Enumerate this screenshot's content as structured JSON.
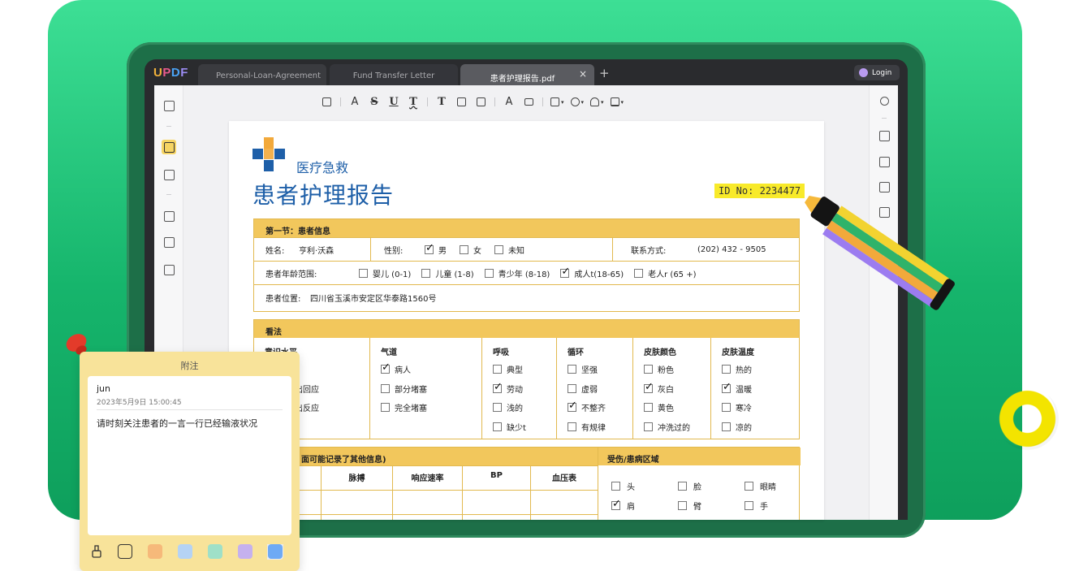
{
  "app": {
    "logo": "UPDF",
    "tabs": [
      {
        "label": "Personal-Loan-Agreement"
      },
      {
        "label": "Fund Transfer Letter"
      },
      {
        "label": "患者护理报告.pdf"
      }
    ],
    "tab_close": "×",
    "tab_add": "+",
    "login_label": "Login"
  },
  "colors": {
    "accent_green": "#16b56c",
    "section_header": "#f2c75c",
    "brand_blue": "#1e5fa8",
    "id_highlight": "#f8ea2a"
  },
  "toolbar": {
    "tools": [
      "comment-icon",
      "highlight-icon",
      "strikethrough-icon",
      "underline-icon",
      "squiggly-icon",
      "text-icon",
      "textbox-icon",
      "text-callout-icon",
      "pencil-icon",
      "eraser-icon",
      "shape-icon",
      "pen-color-icon",
      "stamp-icon",
      "signature-icon"
    ],
    "glyphs": {
      "strike": "S",
      "underline": "U",
      "squiggly": "T",
      "text": "T"
    }
  },
  "document": {
    "brand_name": "医疗急救",
    "title": "患者护理报告",
    "id_label": "ID No: 2234477",
    "section1": {
      "title": "第一节：患者信息",
      "name_label": "姓名:",
      "name_value": "亨利·沃森",
      "gender_label": "性别:",
      "gender_options": [
        {
          "label": "男",
          "checked": true
        },
        {
          "label": "女",
          "checked": false
        },
        {
          "label": "未知",
          "checked": false
        }
      ],
      "contact_label": "联系方式:",
      "contact_value": "(202) 432 - 9505",
      "age_label": "患者年龄范围:",
      "age_options": [
        {
          "label": "婴儿 (0-1)",
          "checked": false
        },
        {
          "label": "儿童 (1-8)",
          "checked": false
        },
        {
          "label": "青少年 (8-18)",
          "checked": false
        },
        {
          "label": "成人t(18-65)",
          "checked": true
        },
        {
          "label": "老人r (65 +)",
          "checked": false
        }
      ],
      "location_label": "患者位置:",
      "location_value": "四川省玉溪市安定区华泰路1560号"
    },
    "section2": {
      "title": "看法",
      "columns": [
        {
          "header": "意识水平",
          "items": [
            {
              "label": "",
              "checked": false
            },
            {
              "label": "音做出回应",
              "checked": false
            },
            {
              "label": "痛做出反应",
              "checked": false
            },
            {
              "label": "应",
              "checked": false
            }
          ]
        },
        {
          "header": "气道",
          "items": [
            {
              "label": "病人",
              "checked": true
            },
            {
              "label": "部分堵塞",
              "checked": false
            },
            {
              "label": "完全堵塞",
              "checked": false
            }
          ]
        },
        {
          "header": "呼吸",
          "items": [
            {
              "label": "典型",
              "checked": false
            },
            {
              "label": "劳动",
              "checked": true
            },
            {
              "label": "浅的",
              "checked": false
            },
            {
              "label": "缺少t",
              "checked": false
            }
          ]
        },
        {
          "header": "循环",
          "items": [
            {
              "label": "坚强",
              "checked": false
            },
            {
              "label": "虚弱",
              "checked": false
            },
            {
              "label": "不整齐",
              "checked": true
            },
            {
              "label": "有规律",
              "checked": false
            }
          ]
        },
        {
          "header": "皮肤颜色",
          "items": [
            {
              "label": "粉色",
              "checked": false
            },
            {
              "label": "灰白",
              "checked": true
            },
            {
              "label": "黄色",
              "checked": false
            },
            {
              "label": "冲洗过的",
              "checked": false
            }
          ]
        },
        {
          "header": "皮肤温度",
          "items": [
            {
              "label": "热的",
              "checked": false
            },
            {
              "label": "温暖",
              "checked": true
            },
            {
              "label": "寒冷",
              "checked": false
            },
            {
              "label": "凉的",
              "checked": false
            }
          ]
        }
      ]
    },
    "section3": {
      "title": "面可能记录了其他信息)",
      "vitals_headers": [
        "脉搏",
        "响应速率",
        "BP",
        "血压表"
      ],
      "injury_title": "受伤/患病区域",
      "injury_options": [
        {
          "label": "头",
          "checked": false
        },
        {
          "label": "脸",
          "checked": false
        },
        {
          "label": "眼睛",
          "checked": false
        },
        {
          "label": "肩",
          "checked": true
        },
        {
          "label": "臂",
          "checked": false
        },
        {
          "label": "手",
          "checked": false
        }
      ]
    }
  },
  "note": {
    "title": "附注",
    "author": "jun",
    "timestamp": "2023年5月9日 15:00:45",
    "text": "请时刻关注患者的一言一行已经输液状况",
    "swatches": [
      "#f6b97a",
      "#b5d3f5",
      "#9fe0c8",
      "#c5b1ee",
      "#6eaaf5"
    ]
  }
}
